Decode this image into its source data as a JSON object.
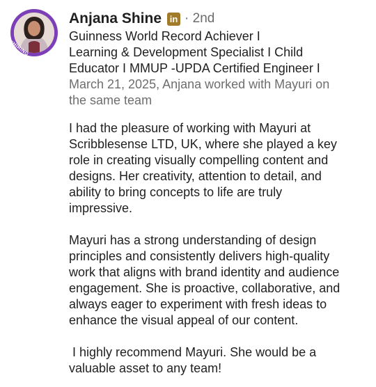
{
  "recommendation": {
    "author": {
      "name": "Anjana Shine",
      "badge_icon": "linkedin-icon",
      "badge_text": "in",
      "degree": "· 2nd",
      "avatar_badge": "#HIRING",
      "headline_lines": [
        "Guinness World Record Achiever I",
        "Learning & Development Specialist I Child",
        "Educator I MMUP -UPDA Certified Engineer I"
      ]
    },
    "meta_lines": [
      "March 21, 2025, Anjana worked with Mayuri on",
      "the same team"
    ],
    "paragraphs": [
      [
        "I had the pleasure of working with Mayuri at",
        "Scribblesense LTD, UK, where she played a key",
        "role in creating visually compelling content and",
        "designs. Her creativity, attention to detail, and",
        "ability to bring concepts to life are truly",
        "impressive."
      ],
      [
        "Mayuri has a strong understanding of design",
        "principles and consistently delivers high-quality",
        "work that aligns with brand identity and audience",
        "engagement. She is proactive, collaborative, and",
        "always eager to experiment with fresh ideas to",
        "enhance the visual appeal of our content."
      ],
      [
        " I highly recommend Mayuri. She would be a",
        "valuable asset to any team!"
      ]
    ]
  },
  "colors": {
    "avatar_ring": "#7c3fb8",
    "badge": "#a17a2a",
    "secondary_text": "#6e6e6e"
  }
}
